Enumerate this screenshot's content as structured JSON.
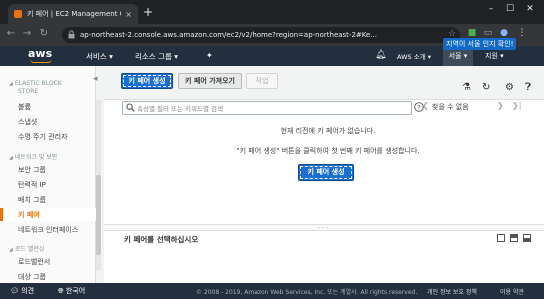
{
  "browser": {
    "tab_title": "키 페어 | EC2 Management Cons",
    "url": "ap-northeast-2.console.aws.amazon.com/ec2/v2/home?region=ap-northeast-2#Ke...",
    "new_tab": "+",
    "tab_close": "×",
    "win_min": "–",
    "win_max": "☐",
    "win_close": "✕"
  },
  "topnav": {
    "logo": "aws",
    "services": "서비스",
    "resource_groups": "리소스 그룹",
    "account": "AWS 소개",
    "region": "서울",
    "support": "지원",
    "tooltip": "지역이 서울 인지 확인!"
  },
  "sidebar": {
    "sections": [
      {
        "title": "ELASTIC BLOCK",
        "title2": "STORE",
        "items": [
          "볼륨",
          "스냅샷",
          "수명 주기 관리자"
        ]
      },
      {
        "title": "네트워크 및 보안",
        "items": [
          "보안 그룹",
          "탄력적 IP",
          "배치 그룹",
          "키 페어",
          "네트워크 인터페이스"
        ]
      },
      {
        "title": "로드 밸런싱",
        "items": [
          "로드밸런서",
          "대상 그룹"
        ]
      }
    ]
  },
  "toolbar": {
    "create_label": "키 페어 생성",
    "import_label": "키 페어 가져오기",
    "actions_label": "작업"
  },
  "search": {
    "placeholder": "속성별 필터 또는 키워드별 검색"
  },
  "pagination": {
    "text": "찾을 수 없음"
  },
  "empty": {
    "line1": "현재 리전에 키 페어가 없습니다.",
    "line2": "\"키 페어 생성\" 버튼을 클릭하여 첫 번째 키 페어를 생성합니다.",
    "button": "키 페어 생성"
  },
  "detail": {
    "title": "키 페어를 선택하십시오"
  },
  "footer": {
    "feedback": "의견",
    "language": "한국어",
    "copyright": "© 2008 - 2019, Amazon Web Services, Inc. 또는 계열사. All rights reserved.",
    "privacy": "개인 정보 보호 정책",
    "terms": "이용 약관"
  },
  "colors": {
    "aws_nav": "#232f3e",
    "accent_orange": "#ec7211",
    "primary_blue": "#1a6fd0",
    "tooltip_blue": "#116ac7"
  }
}
